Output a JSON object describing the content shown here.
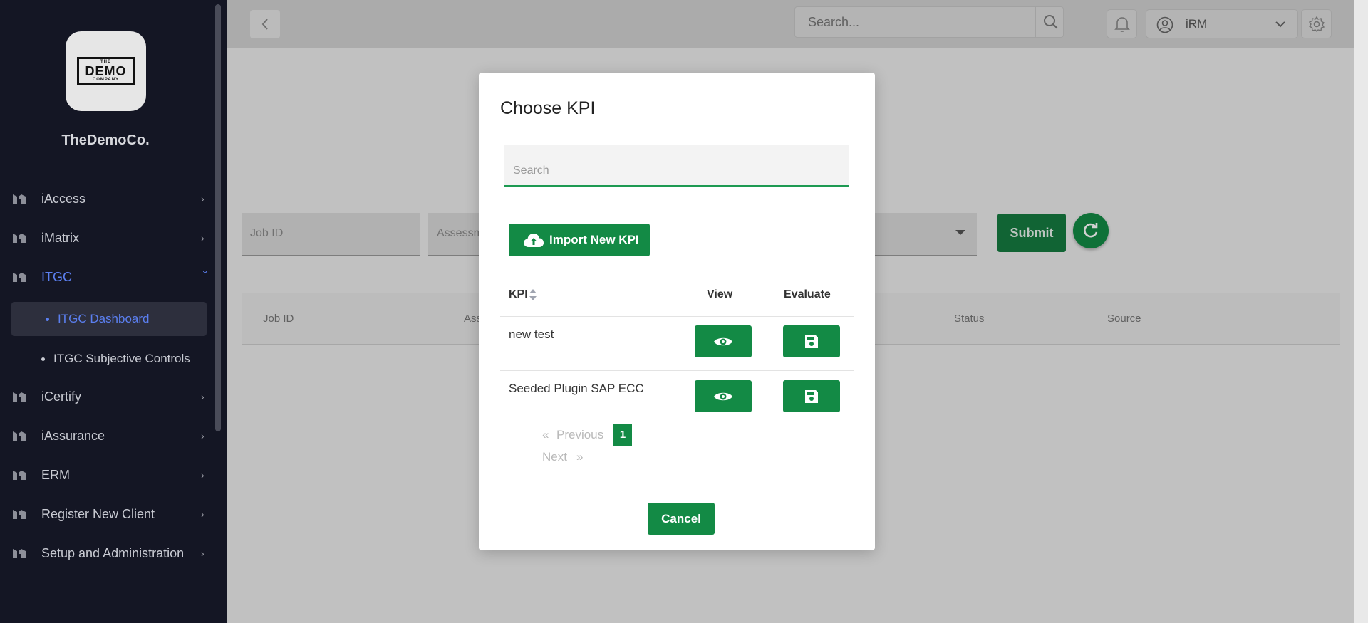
{
  "sidebar": {
    "logo": {
      "top_text": "THE",
      "main_text": "DEMO",
      "bottom_text": "COMPANY"
    },
    "brand": "TheDemoCo.",
    "items": [
      {
        "label": "iAccess",
        "icon": "module-icon",
        "chevron": "›"
      },
      {
        "label": "iMatrix",
        "icon": "module-icon",
        "chevron": "›"
      },
      {
        "label": "ITGC",
        "icon": "module-icon",
        "chevron": "⌄",
        "active": true
      },
      {
        "label": "iCertify",
        "icon": "module-icon",
        "chevron": "›"
      },
      {
        "label": "iAssurance",
        "icon": "module-icon",
        "chevron": "›"
      },
      {
        "label": "ERM",
        "icon": "module-icon",
        "chevron": "›"
      },
      {
        "label": "Register New Client",
        "icon": "module-icon",
        "chevron": "›"
      },
      {
        "label": "Setup and Administration",
        "icon": "module-icon",
        "chevron": "›"
      }
    ],
    "subitems": [
      {
        "label": "ITGC Dashboard",
        "active": true
      },
      {
        "label": "ITGC Subjective Controls",
        "active": false
      }
    ]
  },
  "header": {
    "back_icon": "chevron-left-icon",
    "search_placeholder": "Search...",
    "user_name": "iRM"
  },
  "background": {
    "filters": {
      "job_id_placeholder": "Job ID",
      "assessment_placeholder": "Assessm"
    },
    "submit_label": "Submit",
    "table_headers": [
      "Job ID",
      "Ass",
      "Status",
      "Source"
    ]
  },
  "modal": {
    "title": "Choose KPI",
    "search_placeholder": "Search",
    "import_label": "Import New KPI",
    "columns": {
      "kpi": "KPI",
      "view": "View",
      "evaluate": "Evaluate"
    },
    "rows": [
      {
        "kpi": "new test"
      },
      {
        "kpi": "Seeded Plugin SAP ECC"
      }
    ],
    "pagination": {
      "prev_arrow": "«",
      "previous": "Previous",
      "page": "1",
      "next": "Next",
      "next_arrow": "»"
    },
    "cancel_label": "Cancel"
  },
  "colors": {
    "accent_green": "#138a45",
    "sidebar_bg": "#141624",
    "active_blue": "#5b7ff0"
  }
}
